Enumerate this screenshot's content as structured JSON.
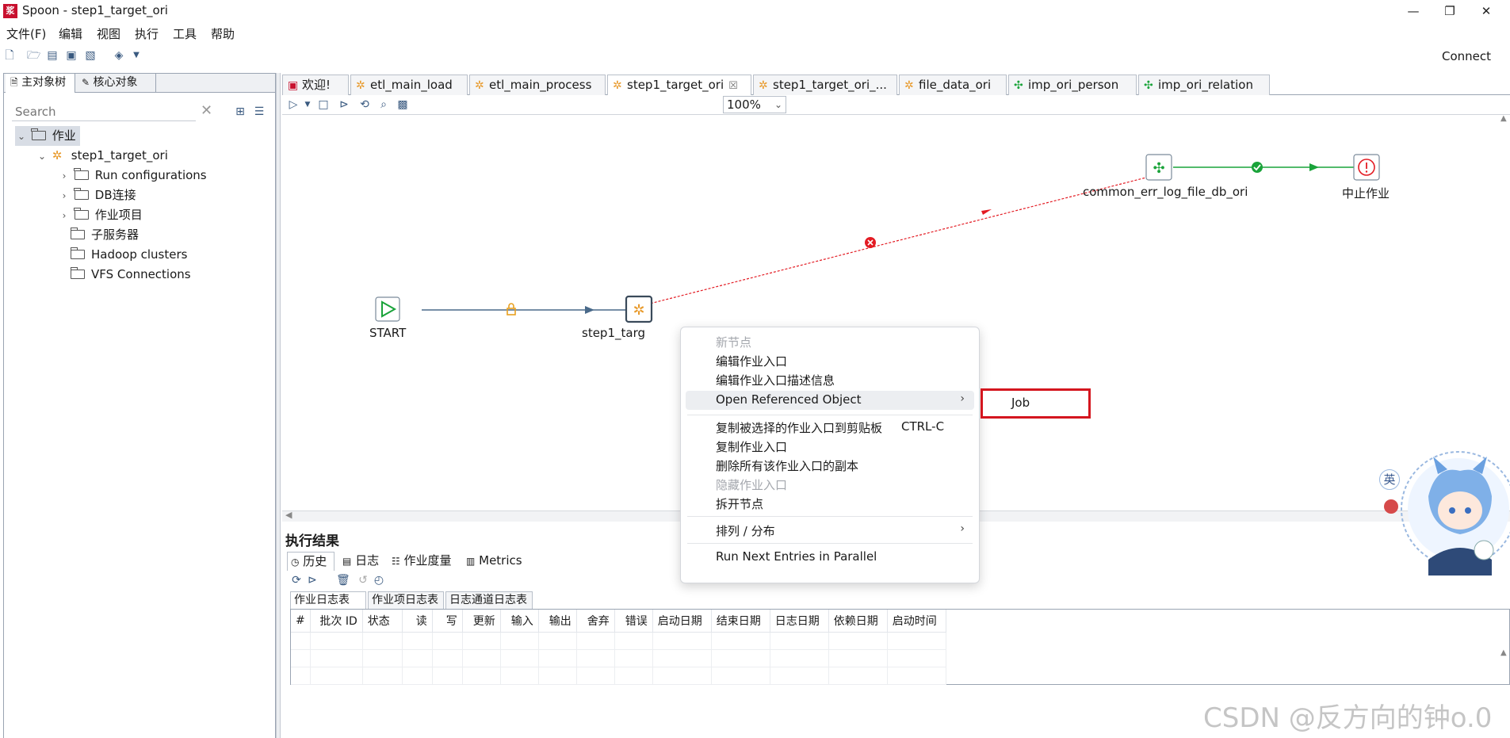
{
  "window": {
    "title": "Spoon - step1_target_ori",
    "logo_text": "浆",
    "controls": {
      "minimize": "—",
      "maximize": "❐",
      "close": "✕"
    }
  },
  "menu": [
    "文件(F)",
    "编辑",
    "视图",
    "执行",
    "工具",
    "帮助"
  ],
  "toolbar": {
    "connect_label": "Connect"
  },
  "left_panel": {
    "tabs": [
      "主对象树",
      "核心对象"
    ],
    "search_placeholder": "Search",
    "tree": {
      "root": "作业",
      "job": "step1_target_ori",
      "children": [
        "Run configurations",
        "DB连接",
        "作业项目",
        "子服务器",
        "Hadoop clusters",
        "VFS Connections"
      ]
    }
  },
  "job_tabs": [
    {
      "label": "欢迎!",
      "icon": "welcome-icon"
    },
    {
      "label": "etl_main_load",
      "icon": "job-icon"
    },
    {
      "label": "etl_main_process",
      "icon": "job-icon"
    },
    {
      "label": "step1_target_ori",
      "icon": "job-icon",
      "active": true,
      "close": "☒"
    },
    {
      "label": "step1_target_ori_...",
      "icon": "job-icon"
    },
    {
      "label": "file_data_ori",
      "icon": "job-icon"
    },
    {
      "label": "imp_ori_person",
      "icon": "transformation-icon"
    },
    {
      "label": "imp_ori_relation",
      "icon": "transformation-icon"
    }
  ],
  "canvas_toolbar": {
    "zoom": "100%"
  },
  "canvas": {
    "nodes": {
      "start": "START",
      "step1": "step1_targ",
      "err": "common_err_log_file_db_ori",
      "abort": "中止作业"
    }
  },
  "context_menu": {
    "items": [
      {
        "label": "新节点",
        "disabled": true
      },
      {
        "label": "编辑作业入口"
      },
      {
        "label": "编辑作业入口描述信息"
      },
      {
        "label": "Open Referenced Object",
        "submenu": true
      },
      {
        "label": "复制被选择的作业入口到剪贴板",
        "shortcut": "CTRL-C"
      },
      {
        "label": "复制作业入口"
      },
      {
        "label": "删除所有该作业入口的副本"
      },
      {
        "label": "隐藏作业入口",
        "disabled": true
      },
      {
        "label": "拆开节点"
      },
      {
        "label": "排列 / 分布",
        "submenu": true
      },
      {
        "label": "Run Next Entries in Parallel"
      }
    ],
    "submenu": {
      "label": "Job"
    }
  },
  "results": {
    "title": "执行结果",
    "tabs": [
      "历史",
      "日志",
      "作业度量",
      "Metrics"
    ],
    "subtabs": [
      "作业日志表",
      "作业项日志表",
      "日志通道日志表"
    ],
    "columns": [
      "#",
      "批次 ID",
      "状态",
      "读",
      "写",
      "更新",
      "输入",
      "输出",
      "舍弃",
      "错误",
      "启动日期",
      "结束日期",
      "日志日期",
      "依赖日期",
      "启动时间"
    ]
  },
  "watermark": "CSDN @反方向的钟o.0",
  "mascot_badge": "英",
  "colors": {
    "accent_red": "#d4161f",
    "hop_blue": "#4a6a8a",
    "hop_red": "#e31b23",
    "hop_green": "#1aa33a",
    "job_orange": "#e89a2c"
  }
}
